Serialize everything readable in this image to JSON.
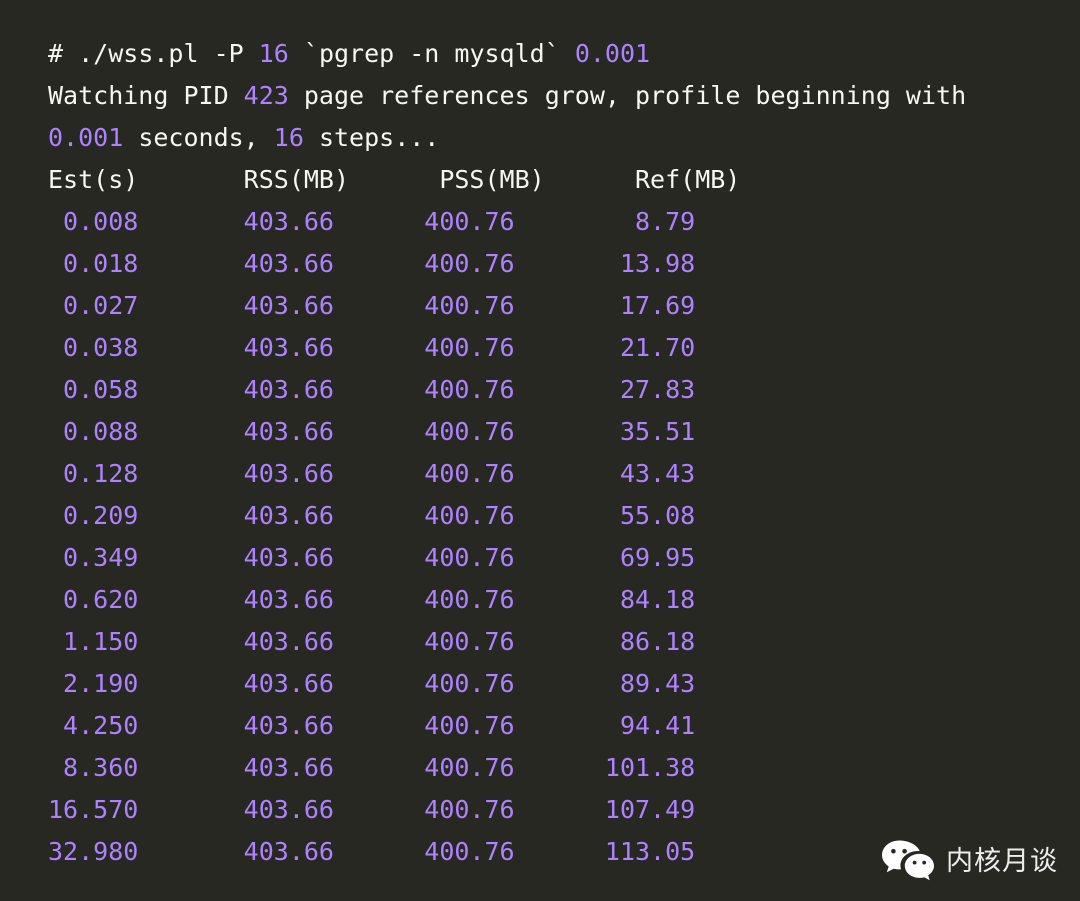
{
  "terminal": {
    "background_color": "#272821",
    "text_color": "#f7f7f2",
    "number_color": "#ae81ff",
    "command_line": {
      "prompt": "# ",
      "command_a": "./wss.pl -P ",
      "arg_steps": "16",
      "command_b": " `pgrep -n mysqld` ",
      "arg_interval": "0.001"
    },
    "status_line_1": {
      "text_a": "Watching PID ",
      "pid": "423",
      "text_b": " page references grow, profile beginning with"
    },
    "status_line_2": {
      "interval": "0.001",
      "text_a": " seconds, ",
      "steps": "16",
      "text_b": " steps..."
    },
    "table": {
      "headers": [
        "Est(s)",
        "RSS(MB)",
        "PSS(MB)",
        "Ref(MB)"
      ],
      "header_line": "Est(s)       RSS(MB)      PSS(MB)      Ref(MB)",
      "rows": [
        {
          "est": "0.008",
          "rss": "403.66",
          "pss": "400.76",
          "ref": "8.79",
          "line": " 0.008       403.66      400.76        8.79"
        },
        {
          "est": "0.018",
          "rss": "403.66",
          "pss": "400.76",
          "ref": "13.98",
          "line": " 0.018       403.66      400.76       13.98"
        },
        {
          "est": "0.027",
          "rss": "403.66",
          "pss": "400.76",
          "ref": "17.69",
          "line": " 0.027       403.66      400.76       17.69"
        },
        {
          "est": "0.038",
          "rss": "403.66",
          "pss": "400.76",
          "ref": "21.70",
          "line": " 0.038       403.66      400.76       21.70"
        },
        {
          "est": "0.058",
          "rss": "403.66",
          "pss": "400.76",
          "ref": "27.83",
          "line": " 0.058       403.66      400.76       27.83"
        },
        {
          "est": "0.088",
          "rss": "403.66",
          "pss": "400.76",
          "ref": "35.51",
          "line": " 0.088       403.66      400.76       35.51"
        },
        {
          "est": "0.128",
          "rss": "403.66",
          "pss": "400.76",
          "ref": "43.43",
          "line": " 0.128       403.66      400.76       43.43"
        },
        {
          "est": "0.209",
          "rss": "403.66",
          "pss": "400.76",
          "ref": "55.08",
          "line": " 0.209       403.66      400.76       55.08"
        },
        {
          "est": "0.349",
          "rss": "403.66",
          "pss": "400.76",
          "ref": "69.95",
          "line": " 0.349       403.66      400.76       69.95"
        },
        {
          "est": "0.620",
          "rss": "403.66",
          "pss": "400.76",
          "ref": "84.18",
          "line": " 0.620       403.66      400.76       84.18"
        },
        {
          "est": "1.150",
          "rss": "403.66",
          "pss": "400.76",
          "ref": "86.18",
          "line": " 1.150       403.66      400.76       86.18"
        },
        {
          "est": "2.190",
          "rss": "403.66",
          "pss": "400.76",
          "ref": "89.43",
          "line": " 2.190       403.66      400.76       89.43"
        },
        {
          "est": "4.250",
          "rss": "403.66",
          "pss": "400.76",
          "ref": "94.41",
          "line": " 4.250       403.66      400.76       94.41"
        },
        {
          "est": "8.360",
          "rss": "403.66",
          "pss": "400.76",
          "ref": "101.38",
          "line": " 8.360       403.66      400.76      101.38"
        },
        {
          "est": "16.570",
          "rss": "403.66",
          "pss": "400.76",
          "ref": "107.49",
          "line": "16.570       403.66      400.76      107.49"
        },
        {
          "est": "32.980",
          "rss": "403.66",
          "pss": "400.76",
          "ref": "113.05",
          "line": "32.980       403.66      400.76      113.05"
        }
      ]
    }
  },
  "watermark": {
    "icon": "wechat-logo-icon",
    "label": "内核月谈",
    "text_color": "#ededed"
  }
}
